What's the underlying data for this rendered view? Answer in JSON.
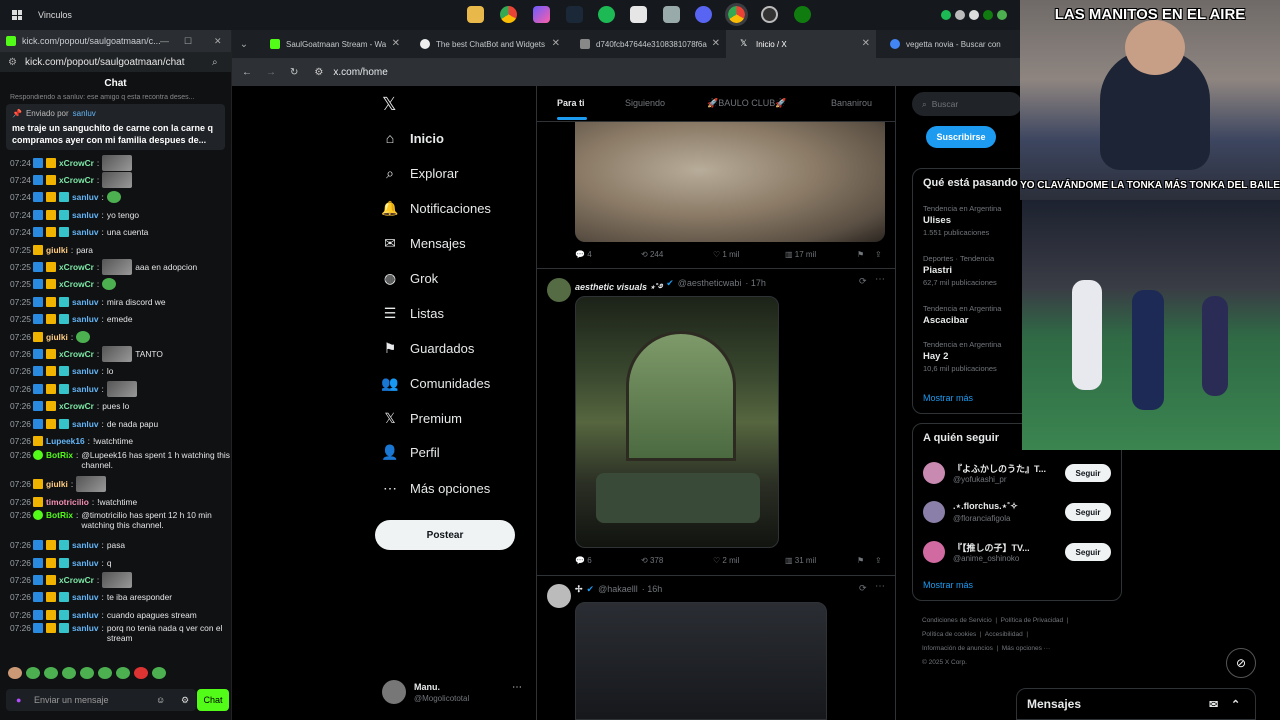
{
  "taskbar": {
    "title": "Vinculos"
  },
  "kick": {
    "window_title": "kick.com/popout/saulgoatmaan/c...",
    "url": "kick.com/popout/saulgoatmaan/chat",
    "chat_header": "Chat",
    "reply_preview": "Respondiendo a sanluv: ese amigo q esta recontra deses...",
    "pinned_by_label": "Enviado por",
    "pinned_by_user": "sanluv",
    "pinned_text": "me traje un sanguchito de carne con la carne q compramos ayer con mi familia despues de...",
    "messages": [
      {
        "time": "07:24",
        "user": "xCrowCr",
        "text": "",
        "color": "#7ee8a6",
        "emote": true
      },
      {
        "time": "07:24",
        "user": "xCrowCr",
        "text": "",
        "color": "#7ee8a6",
        "emote": true
      },
      {
        "time": "07:24",
        "user": "sanluv",
        "text": "",
        "color": "#64b5f6",
        "emote": "sm"
      },
      {
        "time": "07:24",
        "user": "sanluv",
        "text": "yo tengo",
        "color": "#64b5f6"
      },
      {
        "time": "07:24",
        "user": "sanluv",
        "text": "una cuenta",
        "color": "#64b5f6"
      },
      {
        "time": "07:25",
        "user": "giulki",
        "text": "para",
        "color": "#ffcc80"
      },
      {
        "time": "07:25",
        "user": "xCrowCr",
        "text": "aaa en adopcion",
        "color": "#7ee8a6",
        "emote": true
      },
      {
        "time": "07:25",
        "user": "xCrowCr",
        "text": "",
        "color": "#7ee8a6",
        "emote": "sm"
      },
      {
        "time": "07:25",
        "user": "sanluv",
        "text": "mira discord we",
        "color": "#64b5f6"
      },
      {
        "time": "07:25",
        "user": "sanluv",
        "text": "emede",
        "color": "#64b5f6"
      },
      {
        "time": "07:26",
        "user": "giulki",
        "text": "",
        "color": "#ffcc80",
        "emote": "sm"
      },
      {
        "time": "07:26",
        "user": "xCrowCr",
        "text": "TANTO",
        "color": "#7ee8a6",
        "emote": true
      },
      {
        "time": "07:26",
        "user": "sanluv",
        "text": "lo",
        "color": "#64b5f6"
      },
      {
        "time": "07:26",
        "user": "sanluv",
        "text": "",
        "color": "#64b5f6",
        "emote": true
      },
      {
        "time": "07:26",
        "user": "xCrowCr",
        "text": "pues lo",
        "color": "#7ee8a6"
      },
      {
        "time": "07:26",
        "user": "sanluv",
        "text": "de nada papu",
        "color": "#64b5f6"
      },
      {
        "time": "07:26",
        "user": "Lupeek16",
        "text": "!watchtime",
        "color": "#64b5f6"
      },
      {
        "time": "07:26",
        "user": "BotRix",
        "text": "@Lupeek16 has spent 1 h watching this channel.",
        "color": "#53fc18",
        "two": true
      },
      {
        "time": "07:26",
        "user": "giulki",
        "text": "",
        "color": "#ffcc80",
        "emote": true
      },
      {
        "time": "07:26",
        "user": "timotricilio",
        "text": "!watchtime",
        "color": "#f48fb1"
      },
      {
        "time": "07:26",
        "user": "BotRix",
        "text": "@timotricilio has spent 12 h 10 min watching this channel.",
        "color": "#53fc18",
        "two": true
      },
      {
        "time": "07:26",
        "user": "sanluv",
        "text": "pasa",
        "color": "#64b5f6"
      },
      {
        "time": "07:26",
        "user": "sanluv",
        "text": "q",
        "color": "#64b5f6"
      },
      {
        "time": "07:26",
        "user": "xCrowCr",
        "text": "",
        "color": "#7ee8a6",
        "emote": true
      },
      {
        "time": "07:26",
        "user": "sanluv",
        "text": "te iba aresponder",
        "color": "#64b5f6"
      },
      {
        "time": "07:26",
        "user": "sanluv",
        "text": "cuando apagues stream",
        "color": "#64b5f6"
      },
      {
        "time": "07:26",
        "user": "sanluv",
        "text": "porq no tenia nada q ver con el stream",
        "color": "#64b5f6",
        "two": true
      }
    ],
    "input_placeholder": "Enviar un mensaje",
    "chat_button": "Chat"
  },
  "browser": {
    "tabs": [
      {
        "label": "SaulGoatmaan Stream - Wa",
        "color": "#53fc18"
      },
      {
        "label": "The best ChatBot and Widgets",
        "color": "#eeeeee"
      },
      {
        "label": "d740fcb47644e3108381078f6a",
        "color": "#888888"
      },
      {
        "label": "Inicio / X",
        "color": "#ffffff"
      },
      {
        "label": "vegetta novia - Buscar con Go",
        "color": "#4285f4"
      }
    ],
    "url": "x.com/home"
  },
  "x": {
    "nav": [
      {
        "label": "Inicio",
        "icon": "home-icon",
        "glyph": "⌂"
      },
      {
        "label": "Explorar",
        "icon": "search-icon",
        "glyph": "⌕"
      },
      {
        "label": "Notificaciones",
        "icon": "bell-icon",
        "glyph": "🔔"
      },
      {
        "label": "Mensajes",
        "icon": "envelope-icon",
        "glyph": "✉"
      },
      {
        "label": "Grok",
        "icon": "grok-icon",
        "glyph": "◍"
      },
      {
        "label": "Listas",
        "icon": "list-icon",
        "glyph": "☰"
      },
      {
        "label": "Guardados",
        "icon": "bookmark-icon",
        "glyph": "⚑"
      },
      {
        "label": "Comunidades",
        "icon": "people-icon",
        "glyph": "👥"
      },
      {
        "label": "Premium",
        "icon": "x-logo-icon",
        "glyph": "𝕏"
      },
      {
        "label": "Perfil",
        "icon": "person-icon",
        "glyph": "👤"
      },
      {
        "label": "Más opciones",
        "icon": "more-icon",
        "glyph": "⋯"
      }
    ],
    "post_button": "Postear",
    "account": {
      "name": "Manu.",
      "handle": "@Mogolicototal"
    },
    "feed_tabs": [
      "Para ti",
      "Siguiendo",
      "🚀BAULO CLUB🚀",
      "Bananirou"
    ],
    "post1": {
      "replies": "4",
      "reposts": "244",
      "likes": "1 mil",
      "views": "17 mil"
    },
    "post2": {
      "name": "aesthetic visuals ⋆˚࿔",
      "handle": "@aestheticwabi",
      "time": "· 17h",
      "replies": "6",
      "reposts": "378",
      "likes": "2 mil",
      "views": "31 mil"
    },
    "post3": {
      "name": "✢",
      "handle": "@hakaelll",
      "time": "· 16h"
    },
    "search_placeholder": "Buscar",
    "subscribe": "Suscribirse",
    "trends_title": "Qué está pasando",
    "trends": [
      {
        "meta": "Tendencia en Argentina",
        "name": "Ulises",
        "count": "1.551 publicaciones"
      },
      {
        "meta": "Deportes · Tendencia",
        "name": "Piastri",
        "count": "62,7 mil publicaciones"
      },
      {
        "meta": "Tendencia en Argentina",
        "name": "Ascacibar",
        "count": ""
      },
      {
        "meta": "Tendencia en Argentina",
        "name": "Hay 2",
        "count": "10,6 mil publicaciones"
      }
    ],
    "show_more": "Mostrar más",
    "who_follow_title": "A quién seguir",
    "follow": [
      {
        "name": "『よふかしのうた』T...",
        "handle": "@yofukashi_pr",
        "btn": "Seguir",
        "color": "#c98ab2"
      },
      {
        "name": ".⋆.florchus.⋆˚✧",
        "handle": "@floranciafigola",
        "btn": "Seguir",
        "color": "#8a7fa8"
      },
      {
        "name": "『【推しの子】TV...",
        "handle": "@anime_oshinoko",
        "btn": "Seguir",
        "color": "#d06aa0"
      }
    ],
    "show_more_2": "Mostrar más",
    "footer": [
      "Condiciones de Servicio",
      "Política de Privacidad",
      "Política de cookies",
      "Accesibilidad",
      "Información de anuncios",
      "Más opciones ···",
      "© 2025 X Corp."
    ],
    "messages_bar": "Mensajes"
  },
  "overlay": {
    "top_caption": "LAS MANITOS EN EL AIRE",
    "bottom_caption": "YO CLAVÁNDOME LA TONKA MÁS TONKA DEL BAILE"
  }
}
